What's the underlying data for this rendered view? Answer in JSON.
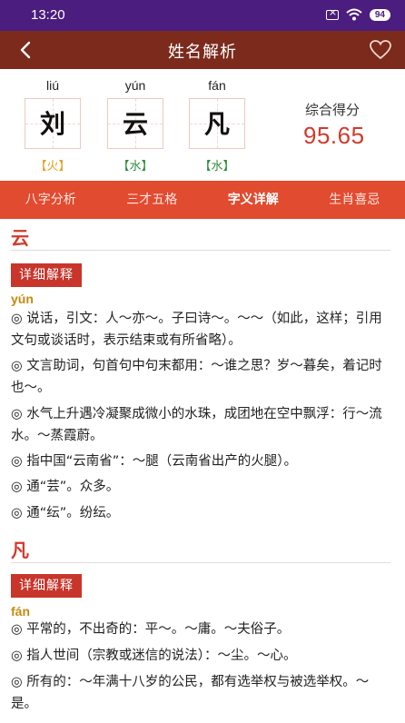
{
  "status": {
    "time": "13:20",
    "battery": "94"
  },
  "header": {
    "title": "姓名解析"
  },
  "name": {
    "chars": [
      {
        "pinyin": "liú",
        "char": "刘",
        "element": "【火】",
        "element_color": "#e0a020"
      },
      {
        "pinyin": "yún",
        "char": "云",
        "element": "【水】",
        "element_color": "#2f8a3a"
      },
      {
        "pinyin": "fán",
        "char": "凡",
        "element": "【水】",
        "element_color": "#2f8a3a"
      }
    ],
    "score_label": "综合得分",
    "score": "95.65"
  },
  "tabs": [
    "八字分析",
    "三才五格",
    "字义详解",
    "生肖喜忌"
  ],
  "active_tab": "字义详解",
  "sections": [
    {
      "title": "云",
      "badge": "详细解释",
      "pinyin": "yún",
      "definitions": [
        "◎ 说话，引文：人～亦～。子曰诗～。～～（如此，这样；引用文句或谈话时，表示结束或有所省略）。",
        "◎ 文言助词，句首句中句末都用：～谁之思？岁～暮矣，着记时也～。",
        "◎ 水气上升遇冷凝聚成微小的水珠，成团地在空中飘浮：行～流水。～蒸霞蔚。",
        "◎ 指中国“云南省”：～腿（云南省出产的火腿）。",
        "◎ 通“芸”。众多。",
        "◎ 通“纭”。纷纭。"
      ]
    },
    {
      "title": "凡",
      "badge": "详细解释",
      "pinyin": "fán",
      "definitions": [
        "◎ 平常的，不出奇的：平～。～庸。～夫俗子。",
        "◎ 指人世间（宗教或迷信的说法）：～尘。～心。",
        "◎ 所有的：～年满十八岁的公民，都有选举权与被选举权。～是。"
      ]
    }
  ],
  "colors": {
    "header": "#7b2a1c",
    "status_bar": "#4a1d7e",
    "tabs": "#e14b30",
    "accent": "#d23a2c",
    "badge": "#c8352b"
  }
}
